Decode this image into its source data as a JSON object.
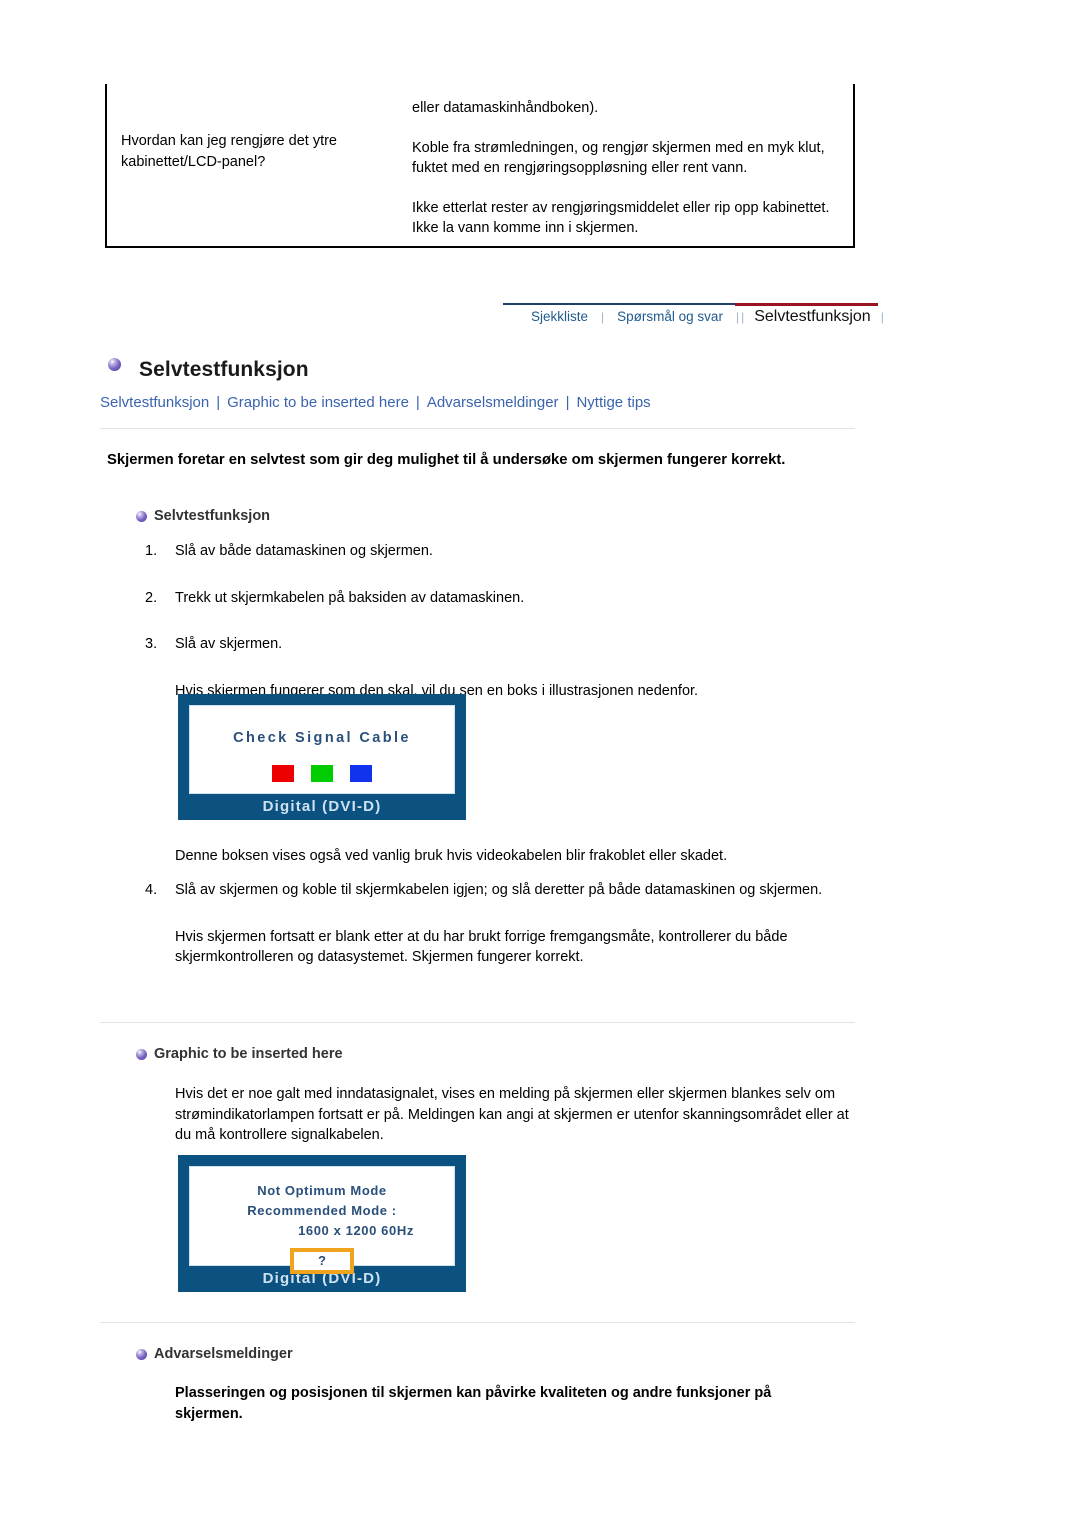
{
  "faq": {
    "question": "Hvordan kan jeg rengjøre det ytre kabinettet/LCD-panel?",
    "answer_top": "eller datamaskinhåndboken).",
    "answer_1": "Koble fra strømledningen, og rengjør skjermen med en myk klut, fuktet med en rengjøringsoppløsning eller rent vann.",
    "answer_2": "Ikke etterlat rester av rengjøringsmiddelet eller rip opp kabinettet. Ikke la vann komme inn i skjermen."
  },
  "tabs": [
    {
      "label": "Sjekkliste",
      "active": false
    },
    {
      "label": "Spørsmål og svar",
      "active": false
    },
    {
      "label": "Selvtestfunksjon",
      "active": true
    }
  ],
  "tab_separator": "|",
  "colors": {
    "tab_rule": "#1f3f66",
    "tab_rule_active": "#981420",
    "link": "#3a63b0",
    "monitor_bezel": "#0c5280",
    "orange_box": "#f0a41e",
    "swatch_red": "#ee0000",
    "swatch_green": "#00cc00",
    "swatch_blue": "#1133ee"
  },
  "page": {
    "title": "Selvtestfunksjon",
    "sublinks": [
      "Selvtestfunksjon",
      "Graphic to be inserted here",
      "Advarselsmeldinger",
      "Nyttige tips"
    ],
    "sublink_divider": "|",
    "intro": "Skjermen foretar en selvtest som gir deg mulighet til å undersøke om skjermen fungerer korrekt."
  },
  "section_selftest": {
    "heading": "Selvtestfunksjon",
    "steps": [
      {
        "num": "1.",
        "text": "Slå av både datamaskinen og skjermen."
      },
      {
        "num": "2.",
        "text": "Trekk ut skjermkabelen på baksiden av datamaskinen."
      },
      {
        "num": "3.",
        "text": "Slå av skjermen."
      }
    ],
    "after_step3": "Hvis skjermen fungerer som den skal, vil du sen en boks i illustrasjonen nedenfor.",
    "after_image": "Denne boksen vises også ved vanlig bruk hvis videokabelen blir frakoblet eller skadet.",
    "step4_num": "4.",
    "step4_text": "Slå av skjermen og koble til skjermkabelen igjen; og slå deretter på både datamaskinen og skjermen.",
    "closing": "Hvis skjermen fortsatt er blank etter at du har brukt forrige fremgangsmåte, kontrollerer du både skjermkontrolleren og datasystemet. Skjermen fungerer korrekt."
  },
  "monitor_check": {
    "title": "Check Signal Cable",
    "caption": "Digital (DVI-D)"
  },
  "section_graphic": {
    "heading": "Graphic to be inserted here",
    "paragraph": "Hvis det er noe galt med inndatasignalet, vises en melding på skjermen eller skjermen blankes selv om strømindikatorlampen fortsatt er på. Meldingen kan angi at skjermen er utenfor skanningsområdet eller at du må kontrollere signalkabelen."
  },
  "monitor_notoptimum": {
    "line1": "Not Optimum Mode",
    "line2": "Recommended Mode :",
    "line3": "1600 x 1200 60Hz",
    "qmark": "?",
    "caption": "Digital (DVI-D)"
  },
  "section_warning": {
    "heading": "Advarselsmeldinger",
    "paragraph": "Plasseringen og posisjonen til skjermen kan påvirke kvaliteten og andre funksjoner på skjermen."
  }
}
